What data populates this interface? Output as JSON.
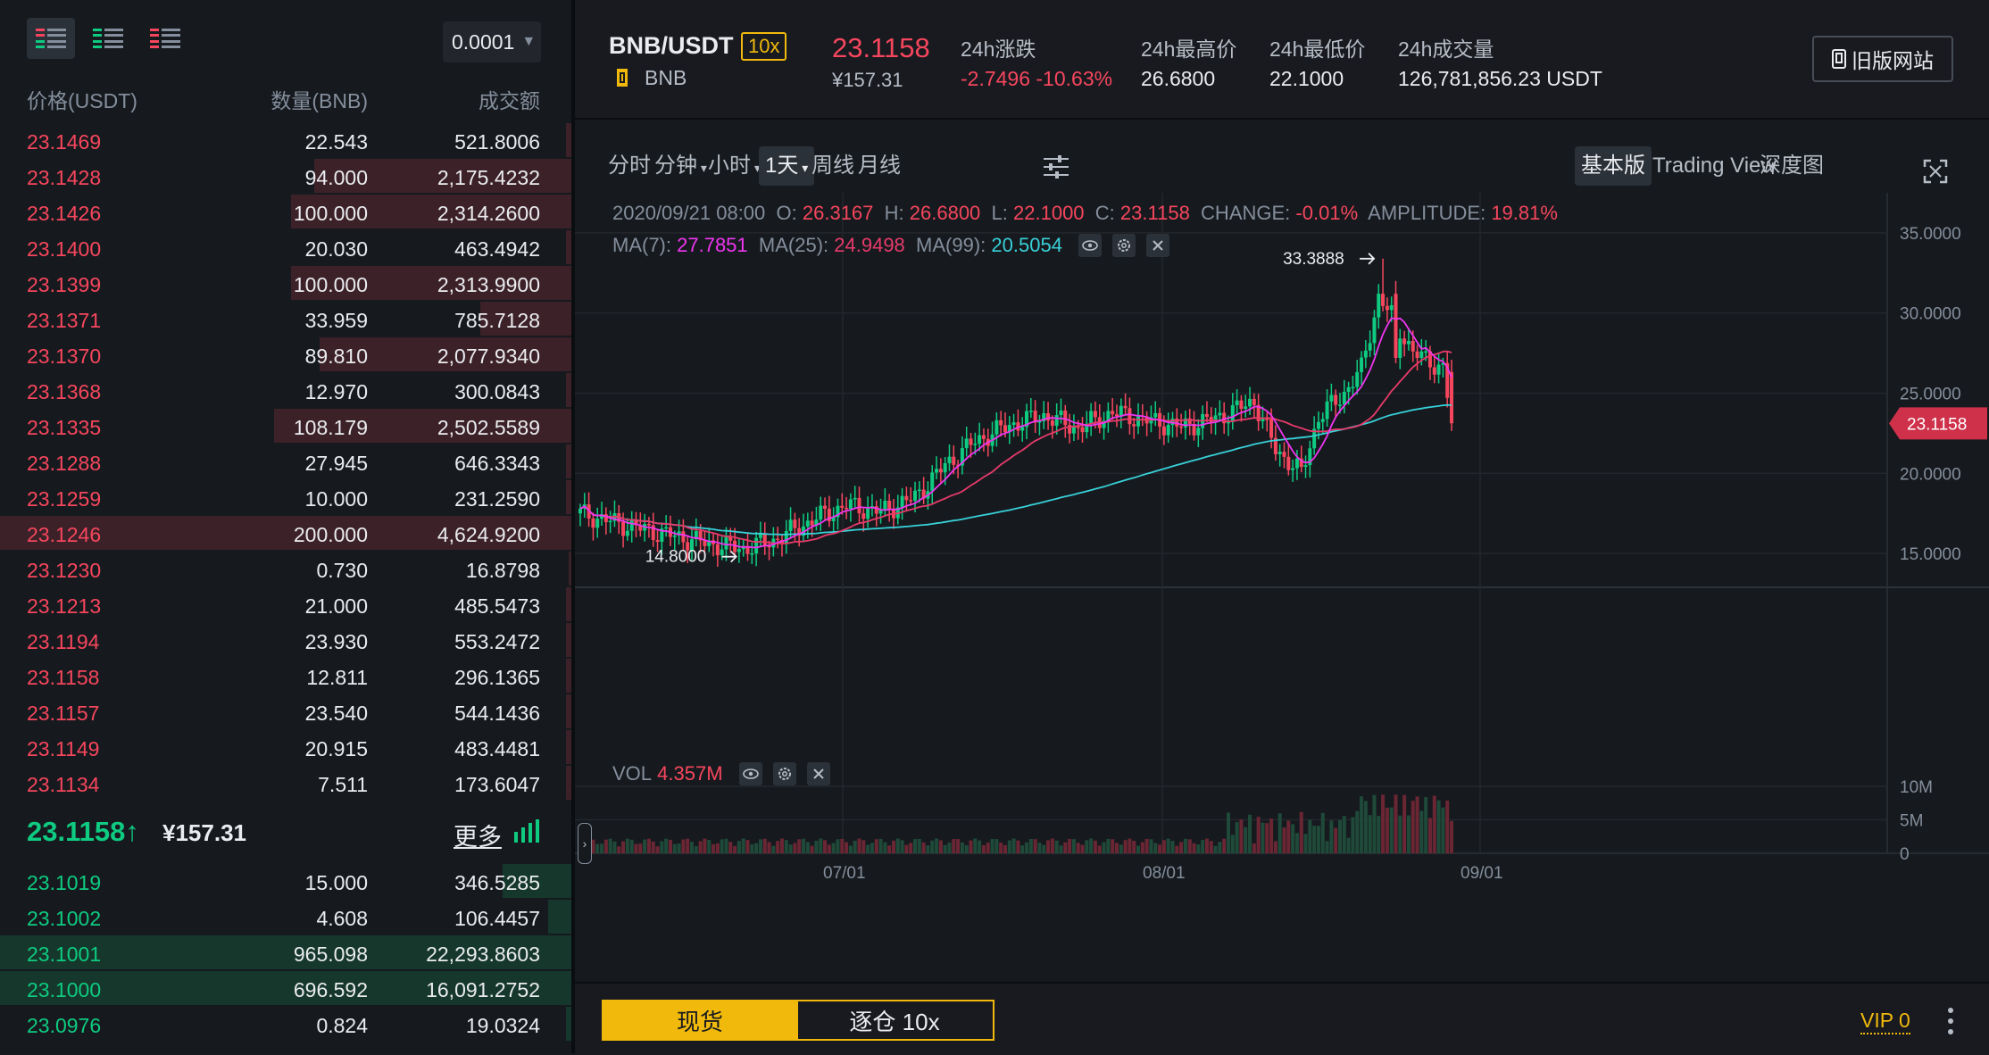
{
  "orderbook": {
    "precision": "0.0001",
    "headers": {
      "price": "价格(USDT)",
      "amount": "数量(BNB)",
      "total": "成交额"
    },
    "asks": [
      {
        "price": "23.1469",
        "amount": "22.543",
        "total": "521.8006",
        "depth": 0.01
      },
      {
        "price": "23.1428",
        "amount": "94.000",
        "total": "2,175.4232",
        "depth": 0.45
      },
      {
        "price": "23.1426",
        "amount": "100.000",
        "total": "2,314.2600",
        "depth": 0.49
      },
      {
        "price": "23.1400",
        "amount": "20.030",
        "total": "463.4942",
        "depth": 0.01
      },
      {
        "price": "23.1399",
        "amount": "100.000",
        "total": "2,313.9900",
        "depth": 0.49
      },
      {
        "price": "23.1371",
        "amount": "33.959",
        "total": "785.7128",
        "depth": 0.16
      },
      {
        "price": "23.1370",
        "amount": "89.810",
        "total": "2,077.9340",
        "depth": 0.44
      },
      {
        "price": "23.1368",
        "amount": "12.970",
        "total": "300.0843",
        "depth": 0.01
      },
      {
        "price": "23.1335",
        "amount": "108.179",
        "total": "2,502.5589",
        "depth": 0.52
      },
      {
        "price": "23.1288",
        "amount": "27.945",
        "total": "646.3343",
        "depth": 0.01
      },
      {
        "price": "23.1259",
        "amount": "10.000",
        "total": "231.2590",
        "depth": 0.01
      },
      {
        "price": "23.1246",
        "amount": "200.000",
        "total": "4,624.9200",
        "depth": 1.0
      },
      {
        "price": "23.1230",
        "amount": "0.730",
        "total": "16.8798",
        "depth": 0.005
      },
      {
        "price": "23.1213",
        "amount": "21.000",
        "total": "485.5473",
        "depth": 0.01
      },
      {
        "price": "23.1194",
        "amount": "23.930",
        "total": "553.2472",
        "depth": 0.01
      },
      {
        "price": "23.1158",
        "amount": "12.811",
        "total": "296.1365",
        "depth": 0.01
      },
      {
        "price": "23.1157",
        "amount": "23.540",
        "total": "544.1436",
        "depth": 0.01
      },
      {
        "price": "23.1149",
        "amount": "20.915",
        "total": "483.4481",
        "depth": 0.01
      },
      {
        "price": "23.1134",
        "amount": "7.511",
        "total": "173.6047",
        "depth": 0.01
      }
    ],
    "last": {
      "price": "23.1158",
      "arrow": "↑",
      "cny": "¥157.31",
      "more": "更多"
    },
    "bids": [
      {
        "price": "23.1019",
        "amount": "15.000",
        "total": "346.5285",
        "depth": 0.12
      },
      {
        "price": "23.1002",
        "amount": "4.608",
        "total": "106.4457",
        "depth": 0.04
      },
      {
        "price": "23.1001",
        "amount": "965.098",
        "total": "22,293.8603",
        "depth": 1.0
      },
      {
        "price": "23.1000",
        "amount": "696.592",
        "total": "16,091.2752",
        "depth": 1.0
      },
      {
        "price": "23.0976",
        "amount": "0.824",
        "total": "19.0324",
        "depth": 0.01
      }
    ]
  },
  "ticker": {
    "symbol": "BNB/USDT",
    "leverage": "10x",
    "asset": "BNB",
    "last_price": "23.1158",
    "last_cny": "¥157.31",
    "stats": [
      {
        "label": "24h涨跌",
        "value": "-2.7496 -10.63%",
        "color": "#f6465d"
      },
      {
        "label": "24h最高价",
        "value": "26.6800",
        "color": "#eaecef"
      },
      {
        "label": "24h最低价",
        "value": "22.1000",
        "color": "#eaecef"
      },
      {
        "label": "24h成交量",
        "value": "126,781,856.23 USDT",
        "color": "#eaecef"
      }
    ],
    "old_site": "旧版网站"
  },
  "toolbar": {
    "intervals": [
      "分时",
      "分钟",
      "小时",
      "1天",
      "周线",
      "月线"
    ],
    "active_interval": "1天",
    "views": [
      "基本版",
      "Trading View",
      "深度图"
    ],
    "active_view": "基本版"
  },
  "info": {
    "date": "2020/09/21 08:00",
    "o_label": "O:",
    "o": "26.3167",
    "h_label": "H:",
    "h": "26.6800",
    "l_label": "L:",
    "l": "22.1000",
    "c_label": "C:",
    "c": "23.1158",
    "change_label": "CHANGE:",
    "change": "-0.01%",
    "amp_label": "AMPLITUDE:",
    "amp": "19.81%",
    "ma7_label": "MA(7):",
    "ma7": "27.7851",
    "ma25_label": "MA(25):",
    "ma25": "24.9498",
    "ma99_label": "MA(99):",
    "ma99": "20.5054",
    "vol_label": "VOL",
    "vol": "4.357M"
  },
  "chart_data": {
    "type": "candlestick",
    "price_axis": [
      "35.0000",
      "30.0000",
      "25.0000",
      "20.0000",
      "15.0000"
    ],
    "price_range": [
      13.0,
      37.5
    ],
    "vol_axis": [
      "10M",
      "5M",
      "0"
    ],
    "x_labels": [
      "07/01",
      "08/01",
      "09/01"
    ],
    "high_marker": "33.3888",
    "low_marker": "14.8000",
    "current_price": "23.1158",
    "colors": {
      "up": "#0ecb81",
      "down": "#f6465d",
      "ma7": "#f035f0",
      "ma25": "#e73a6b",
      "ma99": "#38d0d8"
    }
  },
  "bottom": {
    "spot": "现货",
    "margin": "逐仓 10x",
    "vip": "VIP 0"
  }
}
